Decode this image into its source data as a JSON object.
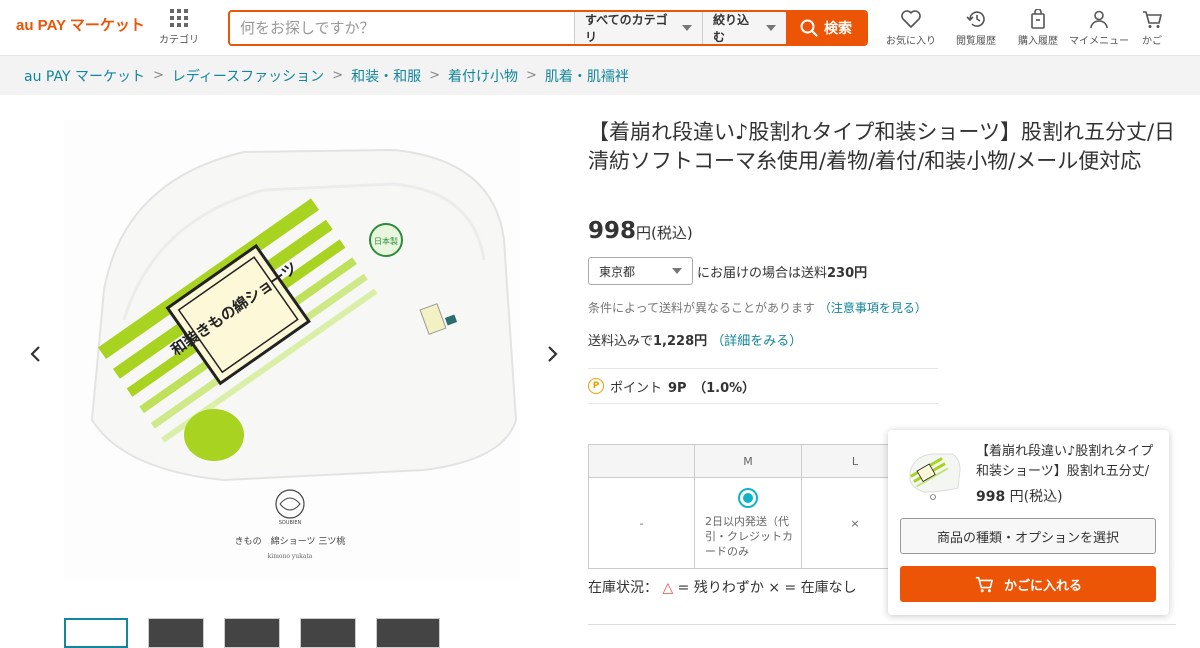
{
  "header": {
    "logo": "au PAY マーケット",
    "category_label": "カテゴリ",
    "search_placeholder": "何をお探しですか？",
    "category_select": "すべてのカテゴリ",
    "narrow_select": "絞り込む",
    "search_button": "検索",
    "nav": [
      {
        "label": "お気に入り",
        "icon": "heart-icon"
      },
      {
        "label": "閲覧履歴",
        "icon": "history-icon"
      },
      {
        "label": "購入履歴",
        "icon": "bag-icon"
      },
      {
        "label": "マイメニュー",
        "icon": "user-icon"
      },
      {
        "label": "かご",
        "icon": "cart-icon"
      }
    ]
  },
  "breadcrumb": [
    "au PAY マーケット",
    "レディースファッション",
    "和装・和服",
    "着付け小物",
    "肌着・肌襦袢"
  ],
  "product": {
    "title": "【着崩れ段違い♪股割れタイプ和装ショーツ】股割れ五分丈/日清紡ソフトコーマ糸使用/着物/着付/和装小物/メール便対応",
    "price": "998",
    "price_suffix": "円(税込)",
    "prefecture": "東京都",
    "shipping_text": "にお届けの場合は送料",
    "shipping_fee": "230円",
    "shipping_note": "条件によって送料が異なることがあります",
    "shipping_note_link": "（注意事項を見る）",
    "total_prefix": "送料込みで",
    "total_value": "1,228円",
    "total_link": "（詳細をみる）",
    "points_label": "ポイント",
    "points_value": "9P　（1.0%）",
    "image_caption": "きもの　綿ショーツ 三ツ桃",
    "image_caption_sub": "kimono yukata",
    "image_logo": "SOUBIEN",
    "package_label": "和装きもの綿ショーツ",
    "package_badge": "日本製"
  },
  "variants": {
    "headers": [
      "",
      "M",
      "L"
    ],
    "row_label": "-",
    "m_status": "2日以内発送（代引・クレジットカードのみ",
    "l_status": "×"
  },
  "stock": {
    "label": "在庫状況：",
    "legend_few": "△",
    "legend_text": " = 残りわずか × = 在庫なし"
  },
  "float_card": {
    "title": "【着崩れ段違い♪股割れタイプ和装ショーツ】股割れ五分丈/日清紡ソフトコーマ糸使用",
    "price": "998",
    "price_suffix": " 円(税込)",
    "option_button": "商品の種類・オプションを選択",
    "cart_button": "かごに入れる"
  },
  "colors": {
    "brand": "#eb5505",
    "link": "#11869c",
    "lime": "#a8d320"
  }
}
